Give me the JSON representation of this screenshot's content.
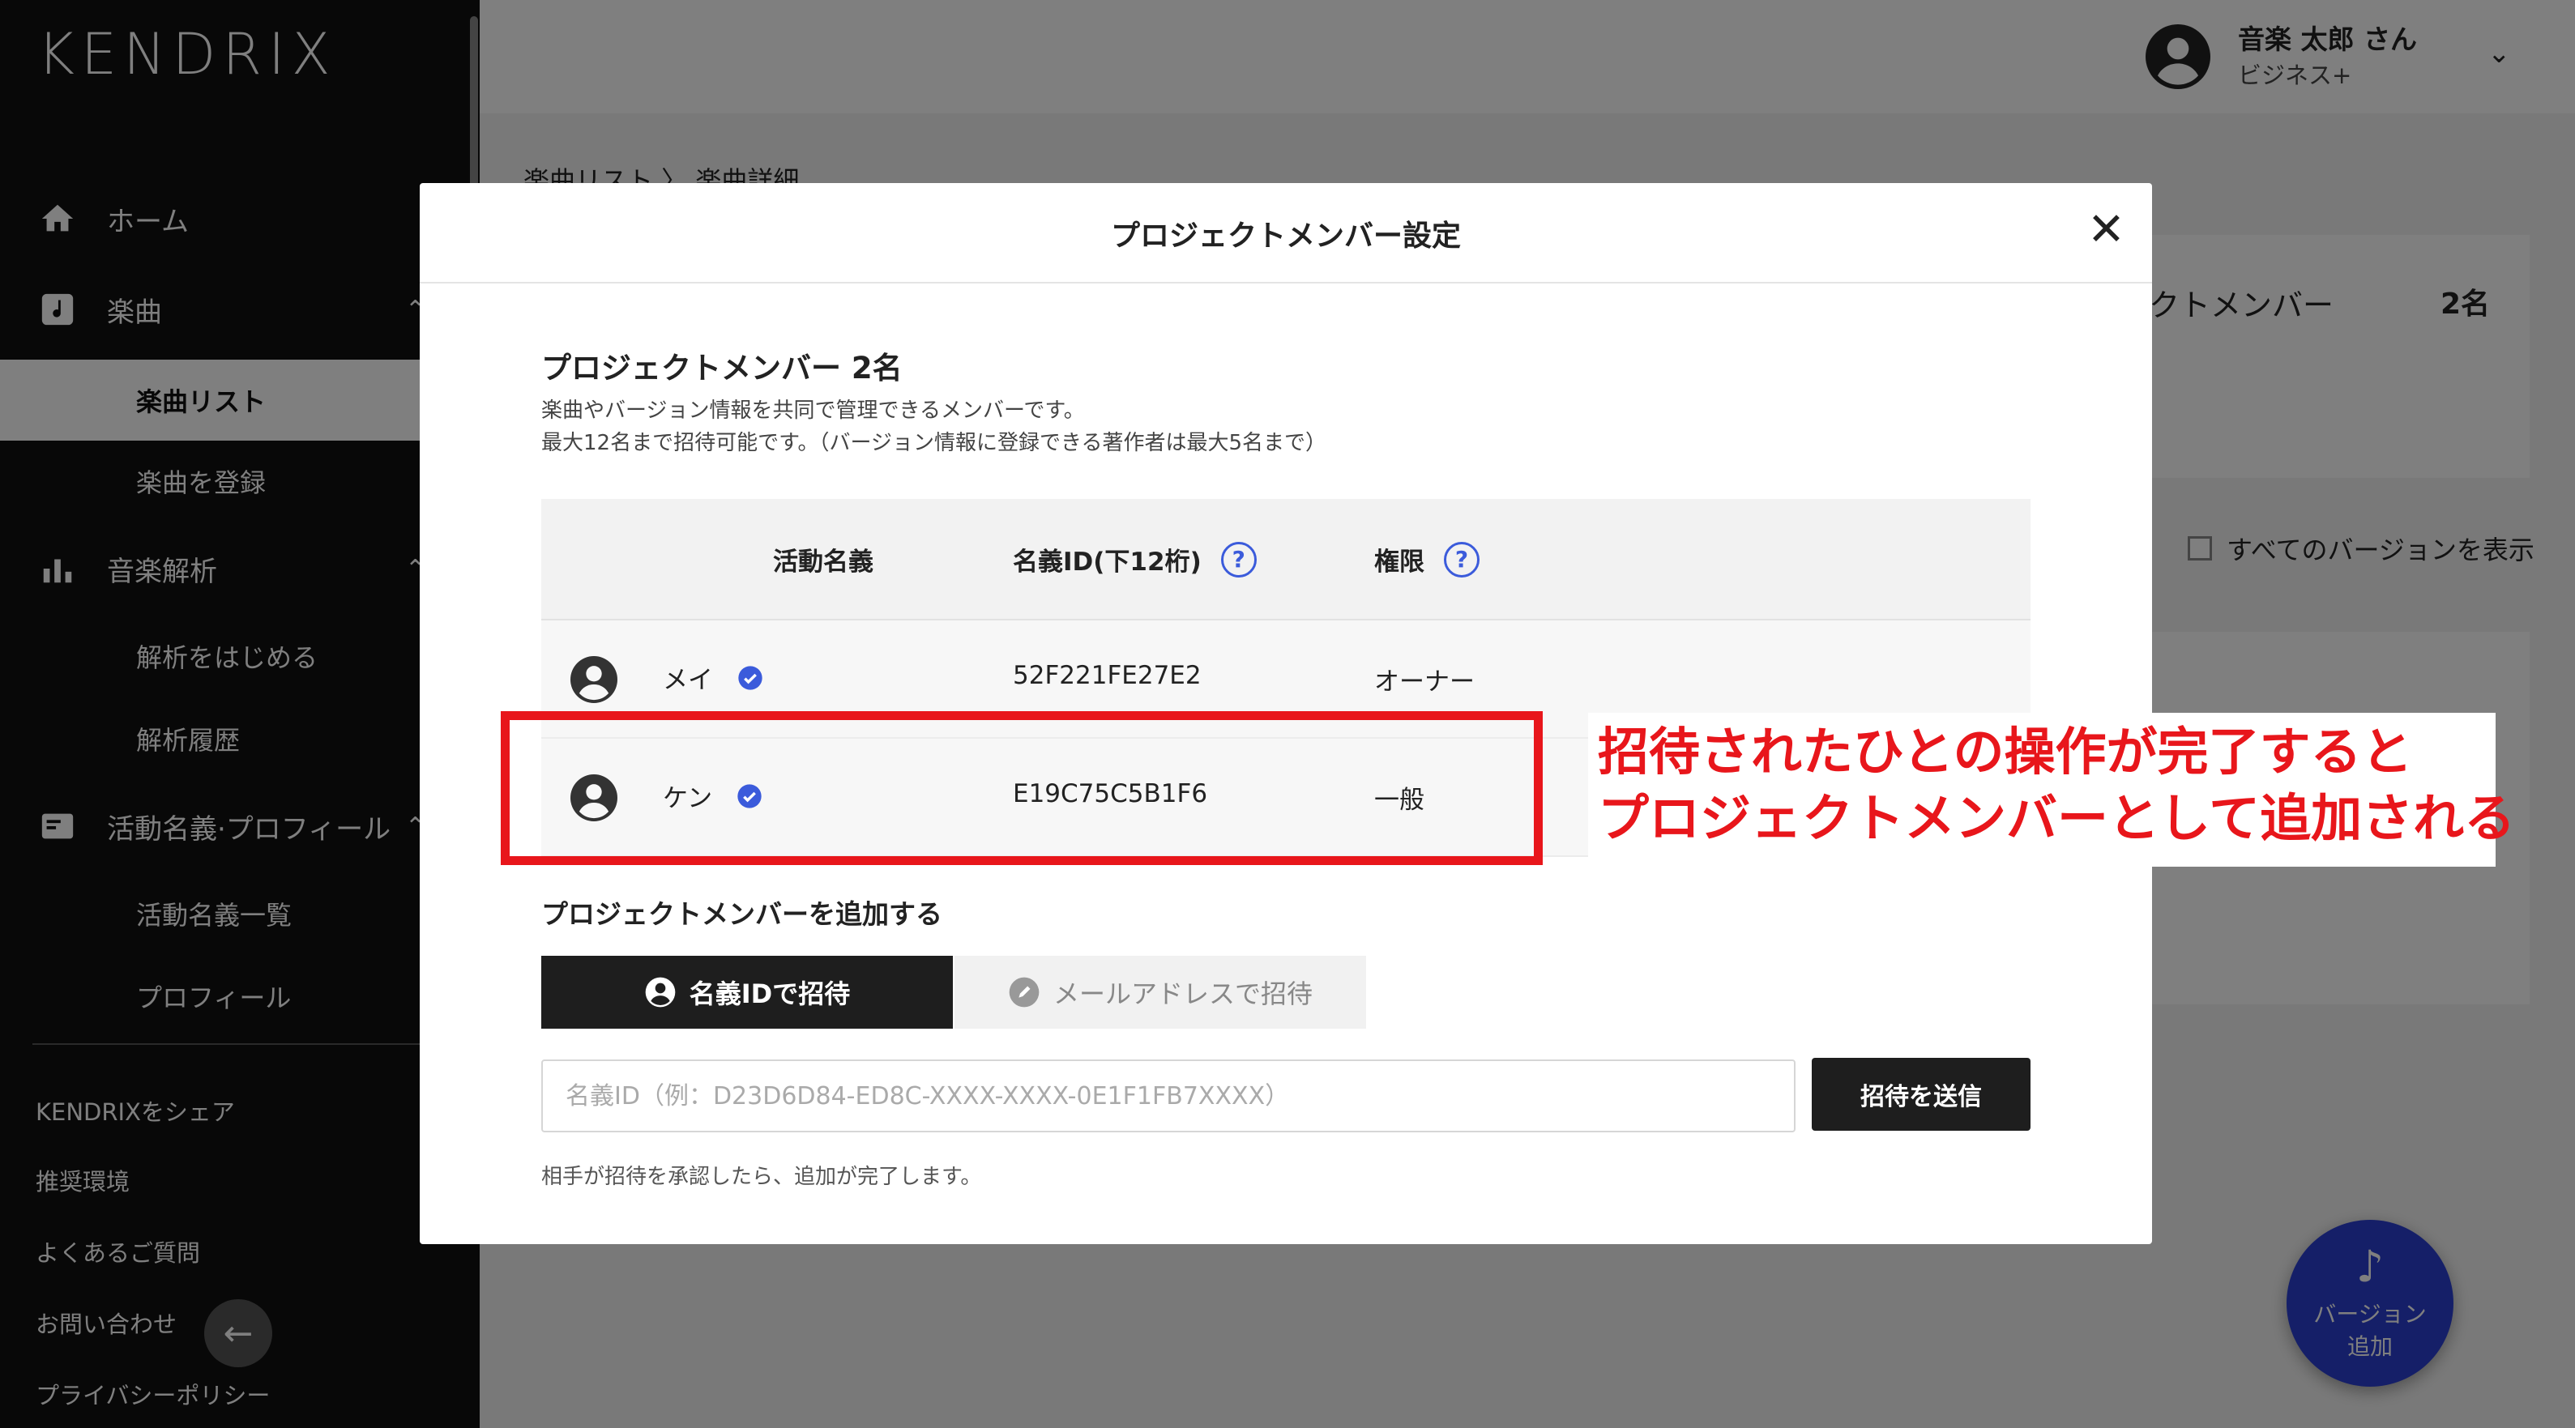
{
  "app": {
    "logo": "KENDRIX"
  },
  "sidebar": {
    "items": [
      {
        "label": "ホーム",
        "icon": "home-icon"
      },
      {
        "label": "楽曲",
        "icon": "music-note-icon"
      },
      {
        "label": "楽曲リスト"
      },
      {
        "label": "楽曲を登録"
      },
      {
        "label": "音楽解析",
        "icon": "bar-chart-icon"
      },
      {
        "label": "解析をはじめる"
      },
      {
        "label": "解析履歴"
      },
      {
        "label": "活動名義·プロフィール",
        "icon": "id-card-icon"
      },
      {
        "label": "活動名義一覧"
      },
      {
        "label": "プロフィール"
      }
    ],
    "footer": [
      "KENDRIXをシェア",
      "推奨環境",
      "よくあるご質問",
      "お問い合わせ",
      "プライバシーポリシー"
    ],
    "back_glyph": "←"
  },
  "header": {
    "user_name": "音楽 太郎 さん",
    "user_plan": "ビジネス+"
  },
  "breadcrumb": "楽曲リスト 〉 楽曲詳細",
  "background_panel": {
    "label": "クトメンバー",
    "count": "2名",
    "show_all": "すべてのバージョンを表示"
  },
  "fab": {
    "glyph": "♪",
    "line1": "バージョン",
    "line2": "追加"
  },
  "modal": {
    "title": "プロジェクトメンバー設定",
    "close_glyph": "✕",
    "section_title": "プロジェクトメンバー 2名",
    "desc1": "楽曲やバージョン情報を共同で管理できるメンバーです。",
    "desc2": "最大12名まで招待可能です。（バージョン情報に登録できる著作者は最大5名まで）",
    "columns": {
      "name": "活動名義",
      "id": "名義ID(下12桁)",
      "role": "権限",
      "help": "?"
    },
    "members": [
      {
        "name": "メイ",
        "id": "52F221FE27E2",
        "role": "オーナー"
      },
      {
        "name": "ケン",
        "id": "E19C75C5B1F6",
        "role": "一般"
      }
    ],
    "add_title": "プロジェクトメンバーを追加する",
    "tabs": [
      {
        "label": "名義IDで招待",
        "icon": "user-icon"
      },
      {
        "label": "メールアドレスで招待",
        "icon": "pencil-icon"
      }
    ],
    "input_placeholder": "名義ID（例：D23D6D84-ED8C-XXXX-XXXX-0E1F1FB7XXXX）",
    "send_label": "招待を送信",
    "hint": "相手が招待を承認したら、追加が完了します。"
  },
  "annotation": {
    "line1": "招待されたひとの操作が完了すると",
    "line2": "プロジェクトメンバーとして追加される",
    "color": "#e8161b"
  }
}
